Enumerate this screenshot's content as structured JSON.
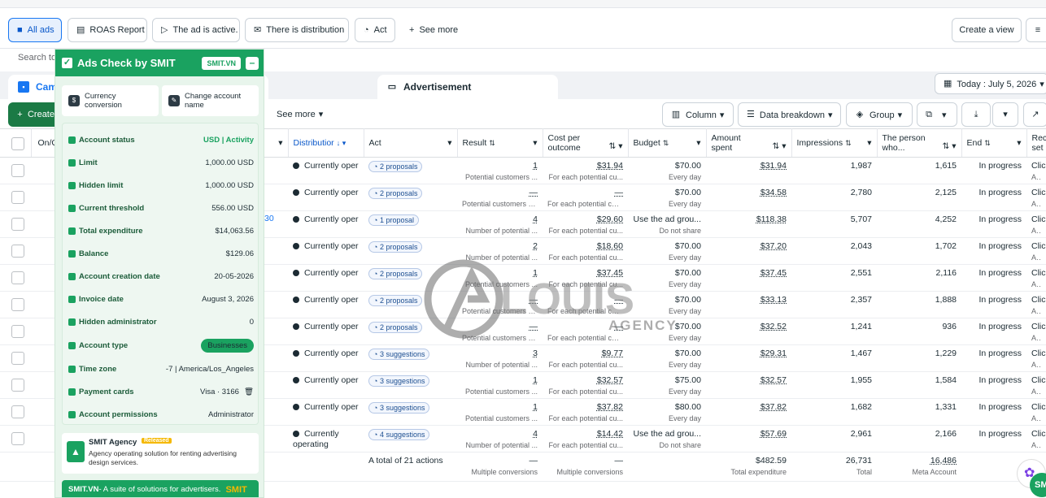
{
  "views": {
    "all_ads": "All ads",
    "roas": "ROAS Report",
    "active": "The ad is active.",
    "distribution": "There is distribution",
    "act": "Act",
    "see_more": "See more",
    "create_view": "Create a view"
  },
  "search": {
    "placeholder": "Search to"
  },
  "tabs": {
    "campaign": "Cam",
    "advertisement": "Advertisement"
  },
  "date_picker": "Today : July 5, 2026",
  "toolbar": {
    "create": "Create",
    "see_more": "See more",
    "column": "Column",
    "breakdown": "Data breakdown",
    "group": "Group"
  },
  "columns": {
    "onoff": "On/O",
    "distribution": "Distributior",
    "act": "Act",
    "result": "Result",
    "cost": "Cost per outcome",
    "budget": "Budget",
    "amount": "Amount spent",
    "impressions": "Impressions",
    "reach": "The person who...",
    "end": "End",
    "rec": "Rec set"
  },
  "rows": [
    {
      "status": "Currently oper",
      "act": "2 proposals",
      "result": "1",
      "result_sub": "Potential customers ...",
      "cost": "$31.94",
      "cost_sub": "For each potential cu...",
      "budget": "$70.00",
      "budget_sub": "Every day",
      "amount": "$31.94",
      "impressions": "1,987",
      "reach": "1,615",
      "end": "In progress",
      "rec": "Clic",
      "rec_sub": "All c"
    },
    {
      "status": "Currently oper",
      "act": "2 proposals",
      "result": "—",
      "result_sub": "Potential customers o...",
      "cost": "—",
      "cost_sub": "For each potential cus...",
      "budget": "$70.00",
      "budget_sub": "Every day",
      "amount": "$34.58",
      "impressions": "2,780",
      "reach": "2,125",
      "end": "In progress",
      "rec": "Clic",
      "rec_sub": "All c"
    },
    {
      "status": "Currently oper",
      "act": "1 proposal",
      "result": "4",
      "result_sub": "Number of potential ...",
      "cost": "$29.60",
      "cost_sub": "For each potential cu...",
      "budget": "Use the ad grou...",
      "budget_sub": "Do not share",
      "amount": "$118.38",
      "impressions": "5,707",
      "reach": "4,252",
      "end": "In progress",
      "rec": "Clic",
      "rec_sub": "All c"
    },
    {
      "status": "Currently oper",
      "act": "2 proposals",
      "result": "2",
      "result_sub": "Number of potential ...",
      "cost": "$18.60",
      "cost_sub": "For each potential cu...",
      "budget": "$70.00",
      "budget_sub": "Every day",
      "amount": "$37.20",
      "impressions": "2,043",
      "reach": "1,702",
      "end": "In progress",
      "rec": "Clic",
      "rec_sub": "All c"
    },
    {
      "status": "Currently oper",
      "act": "2 proposals",
      "result": "1",
      "result_sub": "Potential customers ...",
      "cost": "$37.45",
      "cost_sub": "For each potential cu...",
      "budget": "$70.00",
      "budget_sub": "Every day",
      "amount": "$37.45",
      "impressions": "2,551",
      "reach": "2,116",
      "end": "In progress",
      "rec": "Clic",
      "rec_sub": "All c"
    },
    {
      "status": "Currently oper",
      "act": "2 proposals",
      "result": "—",
      "result_sub": "Potential customers o...",
      "cost": "—",
      "cost_sub": "For each potential cus...",
      "budget": "$70.00",
      "budget_sub": "Every day",
      "amount": "$33.13",
      "impressions": "2,357",
      "reach": "1,888",
      "end": "In progress",
      "rec": "Clic",
      "rec_sub": "All c"
    },
    {
      "status": "Currently oper",
      "act": "2 proposals",
      "result": "—",
      "result_sub": "Potential customers o...",
      "cost": "—",
      "cost_sub": "For each potential cus...",
      "budget": "$70.00",
      "budget_sub": "Every day",
      "amount": "$32.52",
      "impressions": "1,241",
      "reach": "936",
      "end": "In progress",
      "rec": "Clic",
      "rec_sub": "All c"
    },
    {
      "status": "Currently oper",
      "act": "3 suggestions",
      "result": "3",
      "result_sub": "Number of potential ...",
      "cost": "$9.77",
      "cost_sub": "For each potential cu...",
      "budget": "$70.00",
      "budget_sub": "Every day",
      "amount": "$29.31",
      "impressions": "1,467",
      "reach": "1,229",
      "end": "In progress",
      "rec": "Clic",
      "rec_sub": "All c"
    },
    {
      "status": "Currently oper",
      "act": "3 suggestions",
      "result": "1",
      "result_sub": "Potential customers ...",
      "cost": "$32.57",
      "cost_sub": "For each potential cu...",
      "budget": "$75.00",
      "budget_sub": "Every day",
      "amount": "$32.57",
      "impressions": "1,955",
      "reach": "1,584",
      "end": "In progress",
      "rec": "Clic",
      "rec_sub": "All c"
    },
    {
      "status": "Currently oper",
      "act": "3 suggestions",
      "result": "1",
      "result_sub": "Potential customers ...",
      "cost": "$37.82",
      "cost_sub": "For each potential cu...",
      "budget": "$80.00",
      "budget_sub": "Every day",
      "amount": "$37.82",
      "impressions": "1,682",
      "reach": "1,331",
      "end": "In progress",
      "rec": "Clic",
      "rec_sub": "All c"
    },
    {
      "status": "Currently operating",
      "act": "4 suggestions",
      "result": "4",
      "result_sub": "Number of potential ...",
      "cost": "$14.42",
      "cost_sub": "For each potential cu...",
      "budget": "Use the ad grou...",
      "budget_sub": "Do not share",
      "amount": "$57.69",
      "impressions": "2,961",
      "reach": "2,166",
      "end": "In progress",
      "rec": "Clic",
      "rec_sub": "All c"
    }
  ],
  "row3_fragment": "30",
  "totals": {
    "label": "A total of 21 actions",
    "result": "—",
    "result_sub": "Multiple conversions",
    "cost": "—",
    "cost_sub": "Multiple conversions",
    "amount": "$482.59",
    "amount_sub": "Total expenditure",
    "impressions": "26,731",
    "impressions_sub": "Total",
    "reach": "16,486",
    "reach_sub": "Meta Account"
  },
  "panel": {
    "title": "Ads Check by SMIT",
    "badge": "SMIT.VN",
    "currency_btn": "Currency conversion",
    "change_btn": "Change account name",
    "rows": [
      {
        "label": "Account status",
        "value": "USD | Activity"
      },
      {
        "label": "Limit",
        "value": "1,000.00 USD"
      },
      {
        "label": "Hidden limit",
        "value": "1,000.00 USD"
      },
      {
        "label": "Current threshold",
        "value": "556.00 USD"
      },
      {
        "label": "Total expenditure",
        "value": "$14,063.56"
      },
      {
        "label": "Balance",
        "value": "$129.06"
      },
      {
        "label": "Account creation date",
        "value": "20-05-2026"
      },
      {
        "label": "Invoice date",
        "value": "August 3, 2026"
      },
      {
        "label": "Hidden administrator",
        "value": "0"
      },
      {
        "label": "Account type",
        "value": "Businesses"
      },
      {
        "label": "Time zone",
        "value": "-7 | America/Los_Angeles"
      },
      {
        "label": "Payment cards",
        "value": "Visa · 3166"
      },
      {
        "label": "Account permissions",
        "value": "Administrator"
      }
    ],
    "agency_name": "SMIT Agency",
    "agency_tag": "Released",
    "agency_desc": "Agency operating solution for renting advertising design services.",
    "footer_site": "SMIT.VN",
    "footer_text": " - A suite of solutions for advertisers.",
    "footer_logo": "SMIT"
  },
  "watermark": {
    "word1": "LOUIS",
    "word2": "AGENCY"
  },
  "colors": {
    "accent": "#1877f2",
    "panel_green": "#1aa260",
    "create_green": "#1b7a45"
  }
}
